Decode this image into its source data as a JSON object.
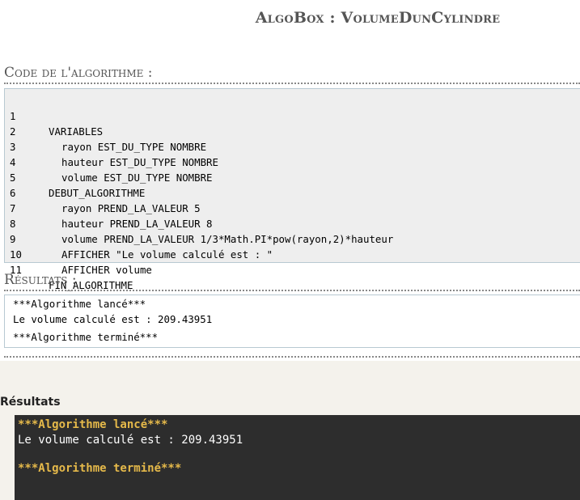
{
  "header": {
    "title": "AlgoBox : VolumeDunCylindre"
  },
  "code_section": {
    "heading": "Code de l'algorithme :",
    "lines": [
      {
        "num": "1",
        "text": "VARIABLES",
        "indent": 0
      },
      {
        "num": "2",
        "text": "rayon EST_DU_TYPE NOMBRE",
        "indent": 1
      },
      {
        "num": "3",
        "text": "hauteur EST_DU_TYPE NOMBRE",
        "indent": 1
      },
      {
        "num": "4",
        "text": "volume EST_DU_TYPE NOMBRE",
        "indent": 1
      },
      {
        "num": "5",
        "text": "DEBUT_ALGORITHME",
        "indent": 0
      },
      {
        "num": "6",
        "text": "rayon PREND_LA_VALEUR 5",
        "indent": 1
      },
      {
        "num": "7",
        "text": "hauteur PREND_LA_VALEUR 8",
        "indent": 1
      },
      {
        "num": "8",
        "text": "volume PREND_LA_VALEUR 1/3*Math.PI*pow(rayon,2)*hauteur",
        "indent": 1
      },
      {
        "num": "9",
        "text": "AFFICHER \"Le volume calculé est : \"",
        "indent": 1
      },
      {
        "num": "10",
        "text": "AFFICHER volume",
        "indent": 1
      },
      {
        "num": "11",
        "text": "FIN_ALGORITHME",
        "indent": 0
      }
    ]
  },
  "results_section": {
    "heading": "Résultats :",
    "lines": [
      "***Algorithme lancé***",
      "Le volume calculé est : 209.43951",
      "***Algorithme terminé***"
    ]
  },
  "console_section": {
    "heading": "Résultats",
    "started": "***Algorithme lancé***",
    "output": "Le volume calculé est : 209.43951",
    "finished": "***Algorithme terminé***"
  },
  "colors": {
    "code_background": "#eeeeee",
    "console_background": "#2d2d2d",
    "console_highlight": "#e5b94a",
    "lower_background": "#f4f2ec"
  }
}
